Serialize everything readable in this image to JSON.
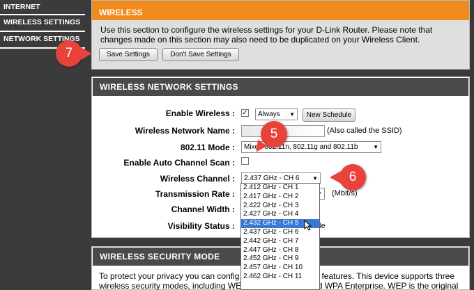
{
  "sidebar": {
    "items": [
      {
        "label": "INTERNET"
      },
      {
        "label": "WIRELESS SETTINGS"
      },
      {
        "label": "NETWORK SETTINGS"
      }
    ]
  },
  "wireless": {
    "title": "WIRELESS",
    "description_line1": "Use this section to configure the wireless settings for your D-Link Router. Please note that",
    "description_line2": "changes made on this section may also need to be duplicated on your Wireless Client.",
    "save_label": "Save Settings",
    "dont_save_label": "Don't Save Settings"
  },
  "network_settings": {
    "title": "WIRELESS NETWORK SETTINGS",
    "enable_wireless_label": "Enable Wireless :",
    "enable_wireless_checked": true,
    "schedule_value": "Always",
    "new_schedule_label": "New Schedule",
    "network_name_label": "Wireless Network Name :",
    "network_name_note": "(Also called the SSID)",
    "mode_label": "802.11 Mode :",
    "mode_value": "Mixed 802.11n, 802.11g and 802.11b",
    "auto_scan_label": "Enable Auto Channel Scan :",
    "auto_scan_checked": false,
    "channel_label": "Wireless Channel :",
    "channel_value": "2.437 GHz - CH 6",
    "tx_rate_label": "Transmission Rate :",
    "tx_rate_unit": "(Mbit/s)",
    "width_label": "Channel Width :",
    "visibility_label": "Visibility Status :",
    "visibility_tail": "le"
  },
  "channel_options": [
    "2.412 GHz - CH 1",
    "2.417 GHz - CH 2",
    "2.422 GHz - CH 3",
    "2.427 GHz - CH 4",
    "2.432 GHz - CH 5",
    "2.437 GHz - CH 6",
    "2.442 GHz - CH 7",
    "2.447 GHz - CH 8",
    "2.452 GHz - CH 9",
    "2.457 GHz - CH 10",
    "2.462 GHz - CH 11"
  ],
  "channel_highlighted_index": 4,
  "security": {
    "title": "WIRELESS SECURITY MODE",
    "text_part1": "To protect your privacy you can config",
    "text_part2": "features. This device supports three",
    "text_line2": "wireless security modes, including WEP, WPA Personal, and WPA Enterprise. WEP is the original"
  },
  "callouts": {
    "step7": "7",
    "step5": "5",
    "step6": "6"
  },
  "colors": {
    "accent_orange": "#f18b1d",
    "callout_red": "#e8423a",
    "header_gray": "#4a4a4a",
    "highlight_blue": "#3a78d4"
  }
}
